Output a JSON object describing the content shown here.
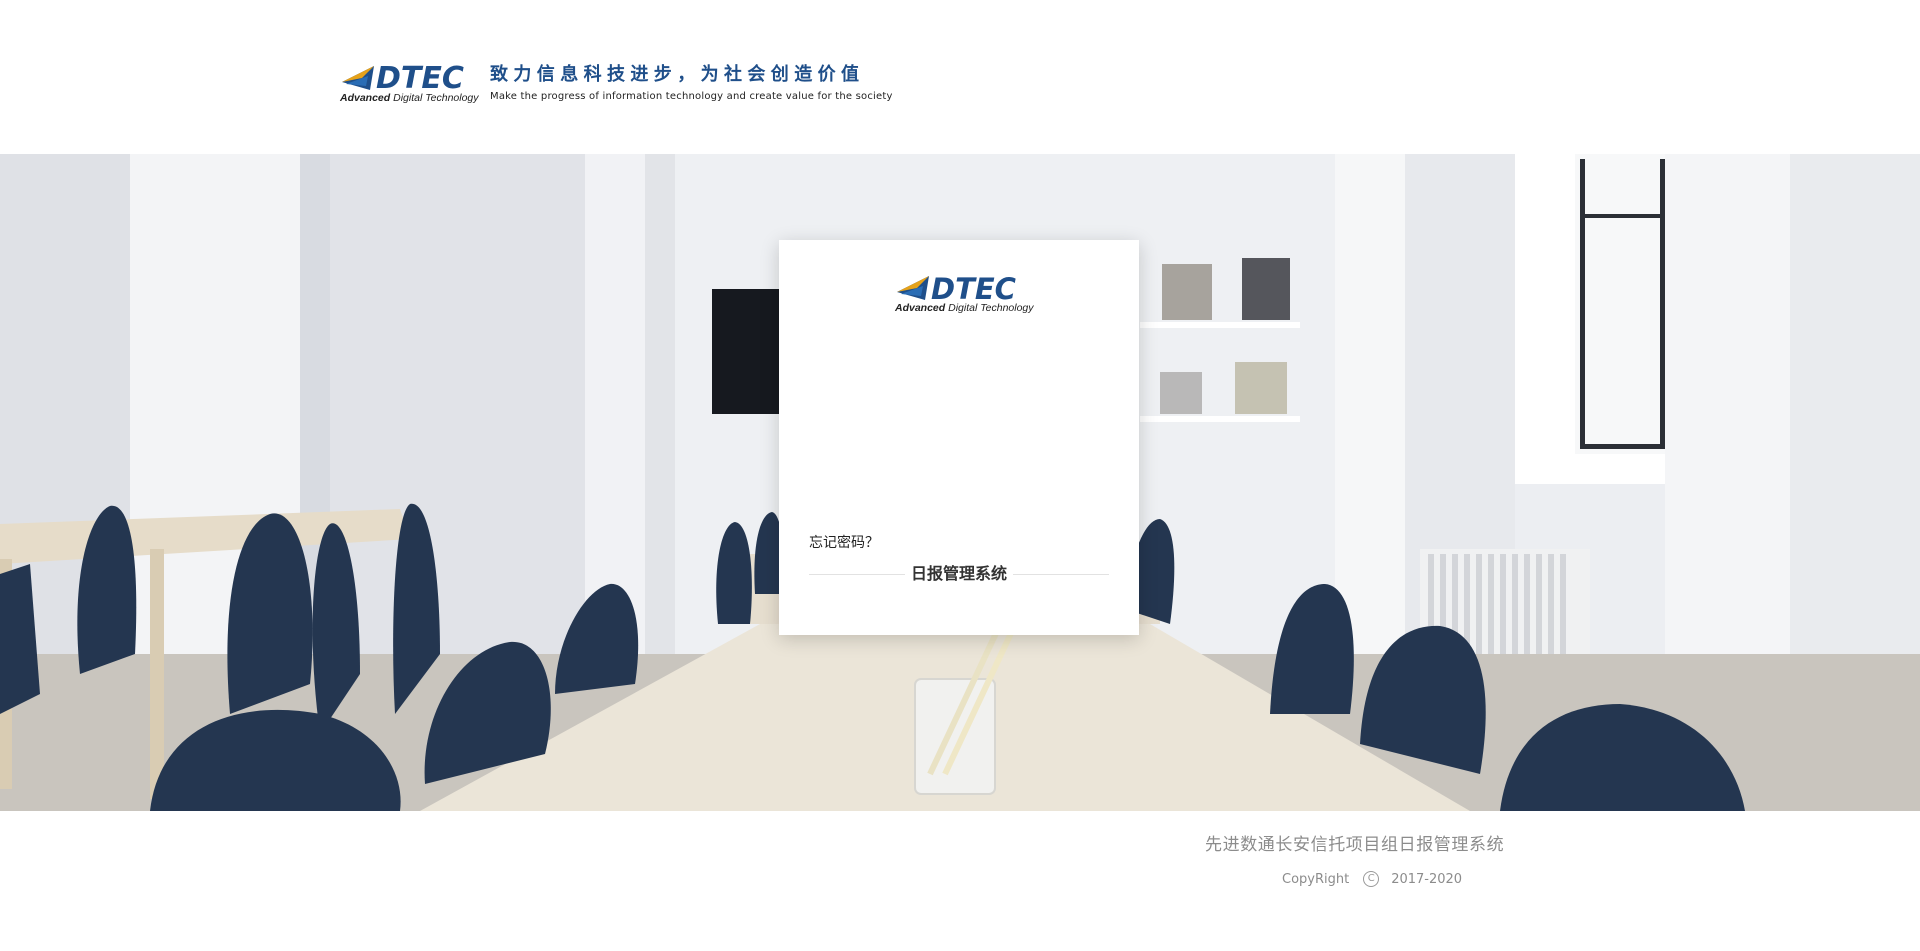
{
  "header": {
    "logo": {
      "wordmark": "DTEC",
      "subtitle_bold": "Advanced",
      "subtitle_rest": " Digital Technology"
    },
    "slogan_cn": "致力信息科技进步，为社会创造价值",
    "slogan_en": "Make the progress of information technology and create value for the society"
  },
  "login_card": {
    "logo": {
      "wordmark": "DTEC",
      "subtitle_bold": "Advanced",
      "subtitle_rest": " Digital Technology"
    },
    "forgot_password": "忘记密码？",
    "system_title": "日报管理系统"
  },
  "footer": {
    "title": "先进数通长安信托项目组日报管理系统",
    "copyright_label": "CopyRight",
    "copyright_symbol": "C",
    "years": "2017-2020"
  },
  "colors": {
    "brand_blue": "#1f4f8a",
    "logo_accent": "#e6a21a",
    "footer_text": "#8c8c8c"
  },
  "icons": [
    "dtec-logo-icon",
    "copyright-icon"
  ]
}
